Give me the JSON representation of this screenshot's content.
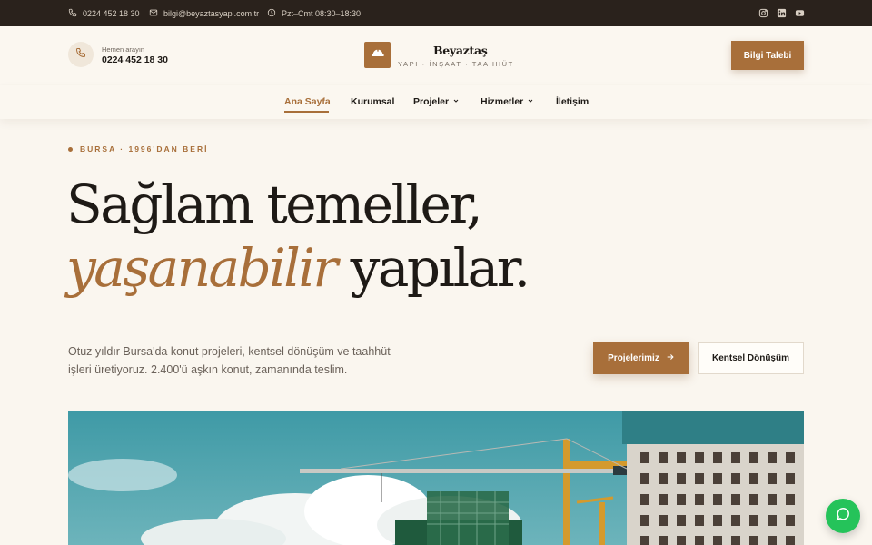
{
  "topbar": {
    "phone": "0224 452 18 30",
    "email": "bilgi@beyaztasyapi.com.tr",
    "hours": "Pzt–Cmt 08:30–18:30",
    "social": [
      "instagram-icon",
      "linkedin-icon",
      "youtube-icon"
    ]
  },
  "header": {
    "call_label": "Hemen arayın",
    "call_number": "0224 452 18 30",
    "brand_name": "Beyaztaş",
    "brand_tagline": "YAPI · İNŞAAT · TAAHHÜT",
    "cta_label": "Bilgi Talebi"
  },
  "nav": {
    "items": [
      {
        "label": "Ana Sayfa",
        "active": true
      },
      {
        "label": "Kurumsal"
      },
      {
        "label": "Projeler",
        "dropdown": true
      },
      {
        "label": "Hizmetler",
        "dropdown": true
      },
      {
        "label": "İletişim"
      }
    ]
  },
  "hero": {
    "eyebrow": "BURSA · 1996'DAN BERİ",
    "headline_line1": "Sağlam temeller,",
    "headline_accent": "yaşanabilir",
    "headline_rest": " yapılar.",
    "lead": "Otuz yıldır Bursa'da konut projeleri, kentsel dönüşüm ve taahhüt işleri üretiyoruz. 2.400'ü aşkın konut, zamanında teslim.",
    "primary_button": "Projelerimiz",
    "secondary_button": "Kentsel Dönüşüm",
    "image": "construction-site-cranes-photo"
  },
  "colors": {
    "accent": "#a86f3a",
    "topbar": "#2a221c",
    "background": "#faf6ef",
    "whatsapp": "#25c35a"
  }
}
